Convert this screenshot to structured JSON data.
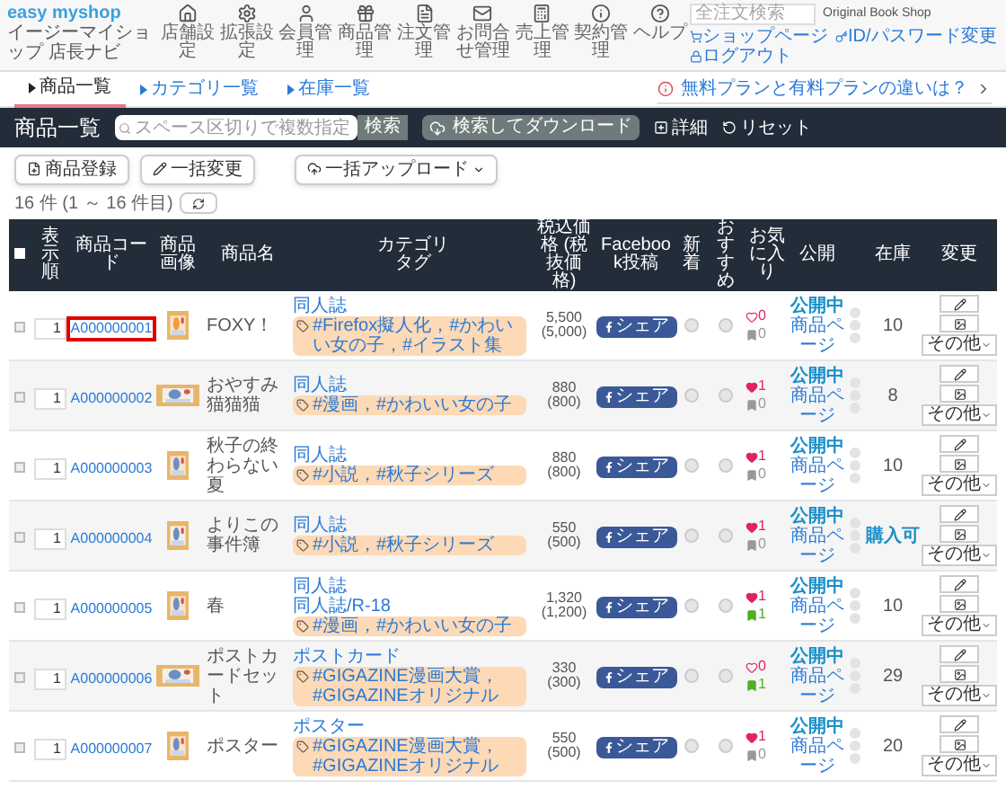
{
  "header": {
    "logo": "easy myshop",
    "subtitle": "イージーマイショップ 店長ナビ",
    "nav": [
      "店舗設定",
      "拡張設定",
      "会員管理",
      "商品管理",
      "注文管理",
      "お問合せ管理",
      "売上管理",
      "契約管理",
      "ヘルプ"
    ],
    "search_placeholder": "全注文検索",
    "shop_name": "Original Book Shop",
    "links": [
      "ショップページ",
      "ID/パスワード変更",
      "ログアウト"
    ]
  },
  "subtabs": [
    {
      "label": "商品一覧",
      "selected": true
    },
    {
      "label": "カテゴリ一覧",
      "selected": false
    },
    {
      "label": "在庫一覧",
      "selected": false
    }
  ],
  "plan_link": "無料プランと有料プランの違いは？",
  "toolbar": {
    "title": "商品一覧",
    "search_placeholder": "スペース区切りで複数指定",
    "search_button": "検索",
    "download_button": "検索してダウンロード",
    "detail": "詳細",
    "reset": "リセット"
  },
  "actions": [
    "商品登録",
    "一括変更",
    "一括アップロード"
  ],
  "count": "16 件 (1 ～ 16 件目)",
  "select_all_checked": false,
  "columns": [
    "表示順",
    "商品コード",
    "商品画像",
    "商品名",
    "カテゴリ",
    "タグ",
    "税込価格 (税抜価格)",
    "Facebook投稿",
    "新着",
    "おすすめ",
    "お気に入り",
    "公開",
    "在庫",
    "変更"
  ],
  "rows": [
    {
      "checked": false,
      "order": "1",
      "code": "A000000001",
      "highlighted": true,
      "name": "FOXY！",
      "categories": [
        "同人誌"
      ],
      "tags": "#Firefox擬人化，#かわいい女の子，#イラスト集",
      "price": "5,500",
      "pretax": "(5,000)",
      "share": "シェア",
      "new": false,
      "recommended": false,
      "hearted": false,
      "hearts": "0",
      "bookmarked": false,
      "bookmarks": "0",
      "public": "公開中",
      "page": "商品ページ",
      "stock": "10",
      "other": "その他"
    },
    {
      "checked": false,
      "order": "1",
      "code": "A000000002",
      "highlighted": false,
      "name": "おやすみ猫猫猫",
      "categories": [
        "同人誌"
      ],
      "tags": "#漫画，#かわいい女の子",
      "price": "880",
      "pretax": "(800)",
      "share": "シェア",
      "new": false,
      "recommended": false,
      "hearted": true,
      "hearts": "1",
      "bookmarked": false,
      "bookmarks": "0",
      "public": "公開中",
      "page": "商品ページ",
      "stock": "8",
      "other": "その他"
    },
    {
      "checked": false,
      "order": "1",
      "code": "A000000003",
      "highlighted": false,
      "name": "秋子の終わらない夏",
      "categories": [
        "同人誌"
      ],
      "tags": "#小説，#秋子シリーズ",
      "price": "880",
      "pretax": "(800)",
      "share": "シェア",
      "new": false,
      "recommended": false,
      "hearted": true,
      "hearts": "1",
      "bookmarked": false,
      "bookmarks": "0",
      "public": "公開中",
      "page": "商品ページ",
      "stock": "10",
      "other": "その他"
    },
    {
      "checked": false,
      "order": "1",
      "code": "A000000004",
      "highlighted": false,
      "name": "よりこの事件簿",
      "categories": [
        "同人誌"
      ],
      "tags": "#小説，#秋子シリーズ",
      "price": "550",
      "pretax": "(500)",
      "share": "シェア",
      "new": false,
      "recommended": false,
      "hearted": true,
      "hearts": "1",
      "bookmarked": false,
      "bookmarks": "0",
      "public": "公開中",
      "page": "商品ページ",
      "stock": "購入可",
      "other": "その他"
    },
    {
      "checked": false,
      "order": "1",
      "code": "A000000005",
      "highlighted": false,
      "name": "春",
      "categories": [
        "同人誌",
        "同人誌/R-18"
      ],
      "tags": "#漫画，#かわいい女の子",
      "price": "1,320",
      "pretax": "(1,200)",
      "share": "シェア",
      "new": false,
      "recommended": false,
      "hearted": true,
      "hearts": "1",
      "bookmarked": true,
      "bookmarks": "1",
      "public": "公開中",
      "page": "商品ページ",
      "stock": "10",
      "other": "その他"
    },
    {
      "checked": false,
      "order": "1",
      "code": "A000000006",
      "highlighted": false,
      "name": "ポストカードセット",
      "categories": [
        "ポストカード"
      ],
      "tags": "#GIGAZINE漫画大賞，#GIGAZINEオリジナル",
      "price": "330",
      "pretax": "(300)",
      "share": "シェア",
      "new": false,
      "recommended": false,
      "hearted": false,
      "hearts": "0",
      "bookmarked": true,
      "bookmarks": "1",
      "public": "公開中",
      "page": "商品ページ",
      "stock": "29",
      "other": "その他"
    },
    {
      "checked": false,
      "order": "1",
      "code": "A000000007",
      "highlighted": false,
      "name": "ポスター",
      "categories": [
        "ポスター"
      ],
      "tags": "#GIGAZINE漫画大賞，#GIGAZINEオリジナル",
      "price": "550",
      "pretax": "(500)",
      "share": "シェア",
      "new": false,
      "recommended": false,
      "hearted": true,
      "hearts": "1",
      "bookmarked": false,
      "bookmarks": "0",
      "public": "公開中",
      "page": "商品ページ",
      "stock": "20",
      "other": "その他"
    }
  ]
}
